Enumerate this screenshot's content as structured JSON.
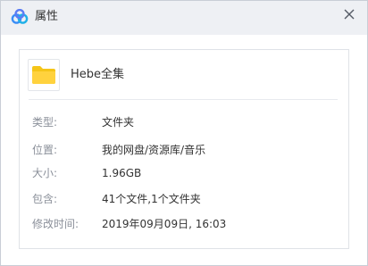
{
  "window": {
    "title": "属性",
    "app_icon": "baidu-netdisk-logo-icon",
    "close_icon": "close-icon"
  },
  "file": {
    "icon": "folder-icon",
    "icon_color": "#f5c518",
    "name": "Hebe全集"
  },
  "properties": [
    {
      "label": "类型:",
      "value": "文件夹"
    },
    {
      "label": "位置:",
      "value": "我的网盘/资源库/音乐"
    },
    {
      "label": "大小:",
      "value": "1.96GB"
    },
    {
      "label": "包含:",
      "value": "41个文件,1个文件夹"
    },
    {
      "label": "修改时间:",
      "value": "2019年09月09日, 16:03"
    }
  ],
  "colors": {
    "titlebar_bg": "#eef0f4",
    "brand_blue": "#3a8ef6",
    "label_gray": "#8a8f99",
    "text": "#333333"
  }
}
